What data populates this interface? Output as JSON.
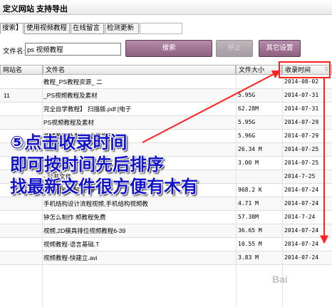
{
  "window": {
    "title": "定义网站 支持导出"
  },
  "tabs": [
    {
      "label": "搜索】",
      "active": true
    },
    {
      "label": "使用视频教程",
      "active": false
    },
    {
      "label": "在线留言",
      "active": false
    },
    {
      "label": "检测更新",
      "active": false
    }
  ],
  "search": {
    "label": "文件名:",
    "value": "ps 视频教程",
    "search_button": "搜索",
    "stop_button": "停止",
    "settings_button": "其它设置"
  },
  "table": {
    "columns": [
      "网站名",
      "文件名",
      "文件大小",
      "收录时间"
    ],
    "sort_indicator": "▽",
    "rows": [
      {
        "site": "",
        "name": "教程_PS教程资源_  二",
        "size": "",
        "time": "2014-08-02"
      },
      {
        "site": "11",
        "name": "_PS视频教程及素材",
        "size": "5.95G",
        "time": "2014-07-31"
      },
      {
        "site": "",
        "name": "完全自学教程】 扫描版.pdf [电子",
        "size": "62.28M",
        "time": "2014-07-31"
      },
      {
        "site": "",
        "name": "PS视频教程及素材",
        "size": "5.95G",
        "time": "2014-07-29"
      },
      {
        "site": "",
        "name": "视频教程及素材_自学学习]",
        "size": "5.96G",
        "time": "2014-07-29"
      },
      {
        "site": "",
        "name": "",
        "size": "26.34 M",
        "time": "2014-07-25"
      },
      {
        "site": "",
        "name": "",
        "size": "3.00 M",
        "time": "2014-07-25"
      },
      {
        "site": "",
        "name": "- 公共文件",
        "size": "",
        "time": "2014-7-25"
      },
      {
        "site": "",
        "name": "视频教程破解版.rar",
        "size": "968.2 K",
        "time": "2014-07-24"
      },
      {
        "site": "",
        "name": "手机结构设计流程视频,手机结构视频教",
        "size": "4.71 M",
        "time": "2014-07-24"
      },
      {
        "site": "",
        "name": "钟怎么制作  频教程免费",
        "size": "57.38M",
        "time": "2014-7-24"
      },
      {
        "site": "",
        "name": "视频,2D模具排位视频教程6-39",
        "size": "36.65 M",
        "time": "2014-07-24"
      },
      {
        "site": "",
        "name": "视频教程-语言基础.T",
        "size": "10.55 M",
        "time": "2014-07-24"
      },
      {
        "site": "",
        "name": "视频教程-快建立.avi",
        "size": "3.83 M",
        "time": "2014-07-24"
      }
    ]
  },
  "annotation": {
    "line1": "⑤点击收录时间",
    "line2": "即可按时间先后排序",
    "line3": "找最新文件很方便有木有",
    "color": "#1313c9",
    "highlight_color": "#ff2020"
  },
  "watermark": "Bai"
}
